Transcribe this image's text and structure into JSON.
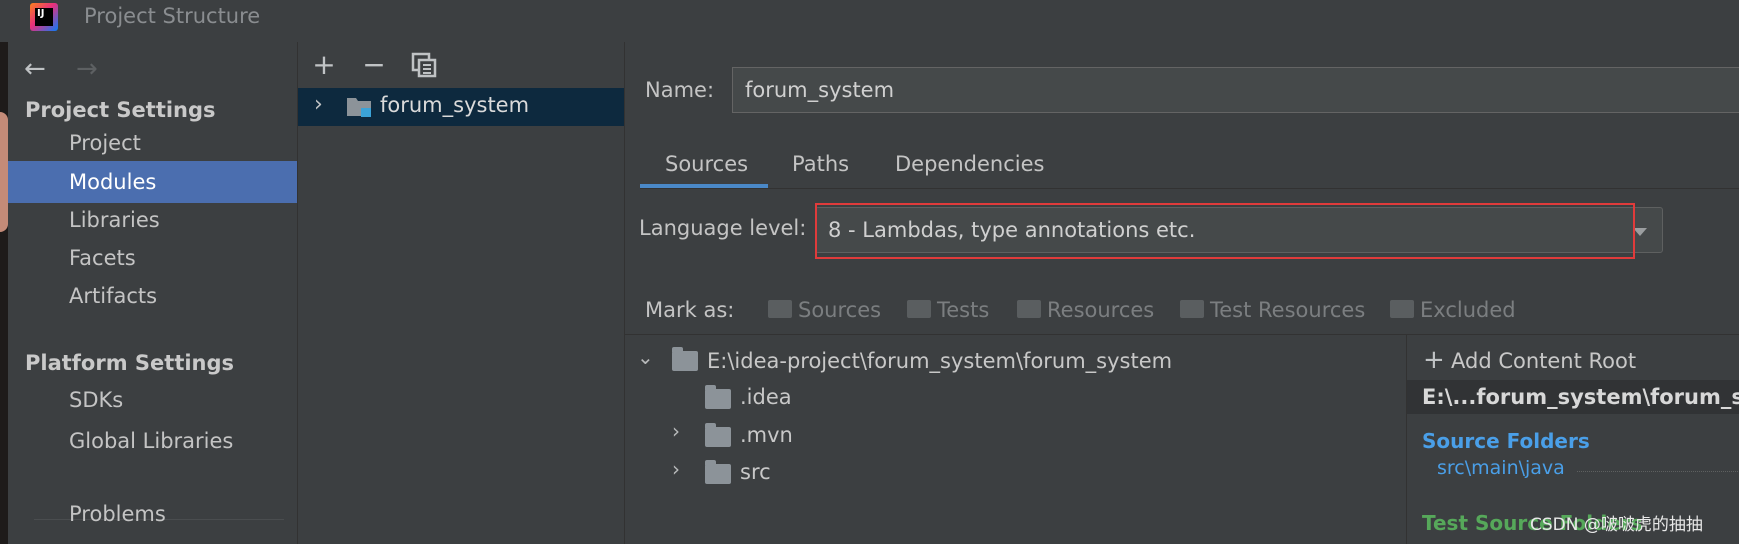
{
  "window": {
    "title": "Project Structure",
    "app_icon_text": "IJ"
  },
  "nav": {
    "back_icon": "arrow-left-icon",
    "forward_icon": "arrow-right-icon",
    "project_settings_heading": "Project Settings",
    "project_settings_items": [
      "Project",
      "Modules",
      "Libraries",
      "Facets",
      "Artifacts"
    ],
    "platform_settings_heading": "Platform Settings",
    "platform_settings_items": [
      "SDKs",
      "Global Libraries"
    ],
    "problems": "Problems",
    "selected": "Modules"
  },
  "modules": {
    "toolbar_icons": [
      "plus-icon",
      "minus-icon",
      "copy-icon"
    ],
    "items": [
      {
        "name": "forum_system",
        "expanded": false,
        "selected": true
      }
    ]
  },
  "module_settings": {
    "name_label": "Name:",
    "name_value": "forum_system",
    "tabs": [
      "Sources",
      "Paths",
      "Dependencies"
    ],
    "active_tab": "Sources",
    "language_level_label": "Language level:",
    "language_level_value": "8 - Lambdas, type annotations etc.",
    "mark_as_label": "Mark as:",
    "mark_as_options": [
      "Sources",
      "Tests",
      "Resources",
      "Test Resources",
      "Excluded"
    ],
    "tree": {
      "root": "E:\\idea-project\\forum_system\\forum_system",
      "children": [
        {
          "name": ".idea",
          "expandable": false
        },
        {
          "name": ".mvn",
          "expandable": true
        },
        {
          "name": "src",
          "expandable": true
        }
      ]
    },
    "content_roots": {
      "add_label": "Add Content Root",
      "root_path": "E:\\...forum_system\\forum_sys",
      "source_folders_heading": "Source Folders",
      "source_folder_path": "src\\main\\java",
      "test_source_folders_heading": "Test Source Folders"
    }
  },
  "watermark": "CSDN @啵啵虎的抽抽",
  "colors": {
    "background": "#3c3f41",
    "selection": "#4b6eaf",
    "tab_underline": "#4a88c7",
    "highlight_box": "#e03b3b",
    "source_folder": "#4a9fe8",
    "test_folder": "#56a85a"
  }
}
